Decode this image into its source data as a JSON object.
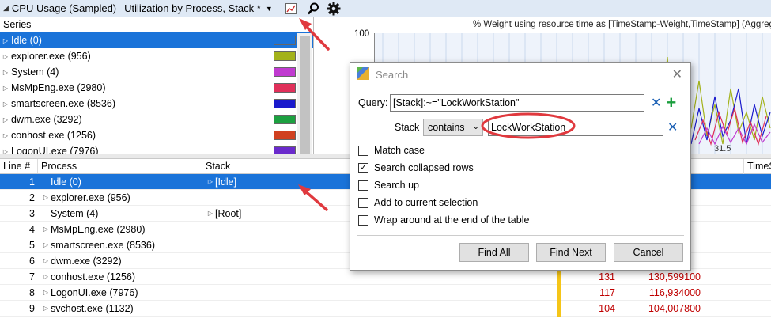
{
  "toolbar": {
    "title": "CPU Usage (Sampled)",
    "preset": "Utilization by Process, Stack *"
  },
  "series_panel": {
    "header": "Series",
    "items": [
      {
        "label": "Idle (0)",
        "color": "#1a73d9"
      },
      {
        "label": "explorer.exe (956)",
        "color": "#a3b21a"
      },
      {
        "label": "System (4)",
        "color": "#c03ad0"
      },
      {
        "label": "MsMpEng.exe (2980)",
        "color": "#e0305a"
      },
      {
        "label": "smartscreen.exe (8536)",
        "color": "#1a1acc"
      },
      {
        "label": "dwm.exe (3292)",
        "color": "#1ca040"
      },
      {
        "label": "conhost.exe (1256)",
        "color": "#d04020"
      },
      {
        "label": "LogonUI.exe (7976)",
        "color": "#6a2acc"
      }
    ]
  },
  "graph": {
    "title": "% Weight using resource time as [TimeStamp-Weight,TimeStamp] (Aggregation: Su",
    "y_max_label": "100",
    "x_tick_label": "31.5"
  },
  "table": {
    "columns": [
      "Line #",
      "Process",
      "Stack",
      "TimeS"
    ],
    "rows": [
      {
        "line": "1",
        "process": "Idle (0)",
        "stack": "[Idle]",
        "n1": "",
        "n2": ""
      },
      {
        "line": "2",
        "process": "explorer.exe (956)",
        "stack": "",
        "n1": "",
        "n2": ""
      },
      {
        "line": "3",
        "process": "System (4)",
        "stack": "[Root]",
        "n1": "",
        "n2": ""
      },
      {
        "line": "4",
        "process": "MsMpEng.exe (2980)",
        "stack": "",
        "n1": "",
        "n2": ""
      },
      {
        "line": "5",
        "process": "smartscreen.exe (8536)",
        "stack": "",
        "n1": "",
        "n2": ""
      },
      {
        "line": "6",
        "process": "dwm.exe (3292)",
        "stack": "",
        "n1": "",
        "n2": ""
      },
      {
        "line": "7",
        "process": "conhost.exe (1256)",
        "stack": "",
        "n1": "131",
        "n2": "130,599100"
      },
      {
        "line": "8",
        "process": "LogonUI.exe (7976)",
        "stack": "",
        "n1": "117",
        "n2": "116,934000"
      },
      {
        "line": "9",
        "process": "svchost.exe (1132)",
        "stack": "",
        "n1": "104",
        "n2": "104,007800"
      }
    ]
  },
  "dialog": {
    "title": "Search",
    "query_label": "Query:",
    "query_value": "[Stack]:~=\"LockWorkStation\"",
    "stack_label": "Stack",
    "operator": "contains",
    "stack_value": "LockWorkStation",
    "options": [
      {
        "label": "Match case",
        "checked": false
      },
      {
        "label": "Search collapsed rows",
        "checked": true
      },
      {
        "label": "Search up",
        "checked": false
      },
      {
        "label": "Add to current selection",
        "checked": false
      },
      {
        "label": "Wrap around at the end of the table",
        "checked": false
      }
    ],
    "buttons": {
      "find_all": "Find All",
      "find_next": "Find Next",
      "cancel": "Cancel"
    }
  },
  "colors": {
    "accent": "#1a73d9",
    "annotation": "#e0393e",
    "value_text": "#c00000"
  }
}
